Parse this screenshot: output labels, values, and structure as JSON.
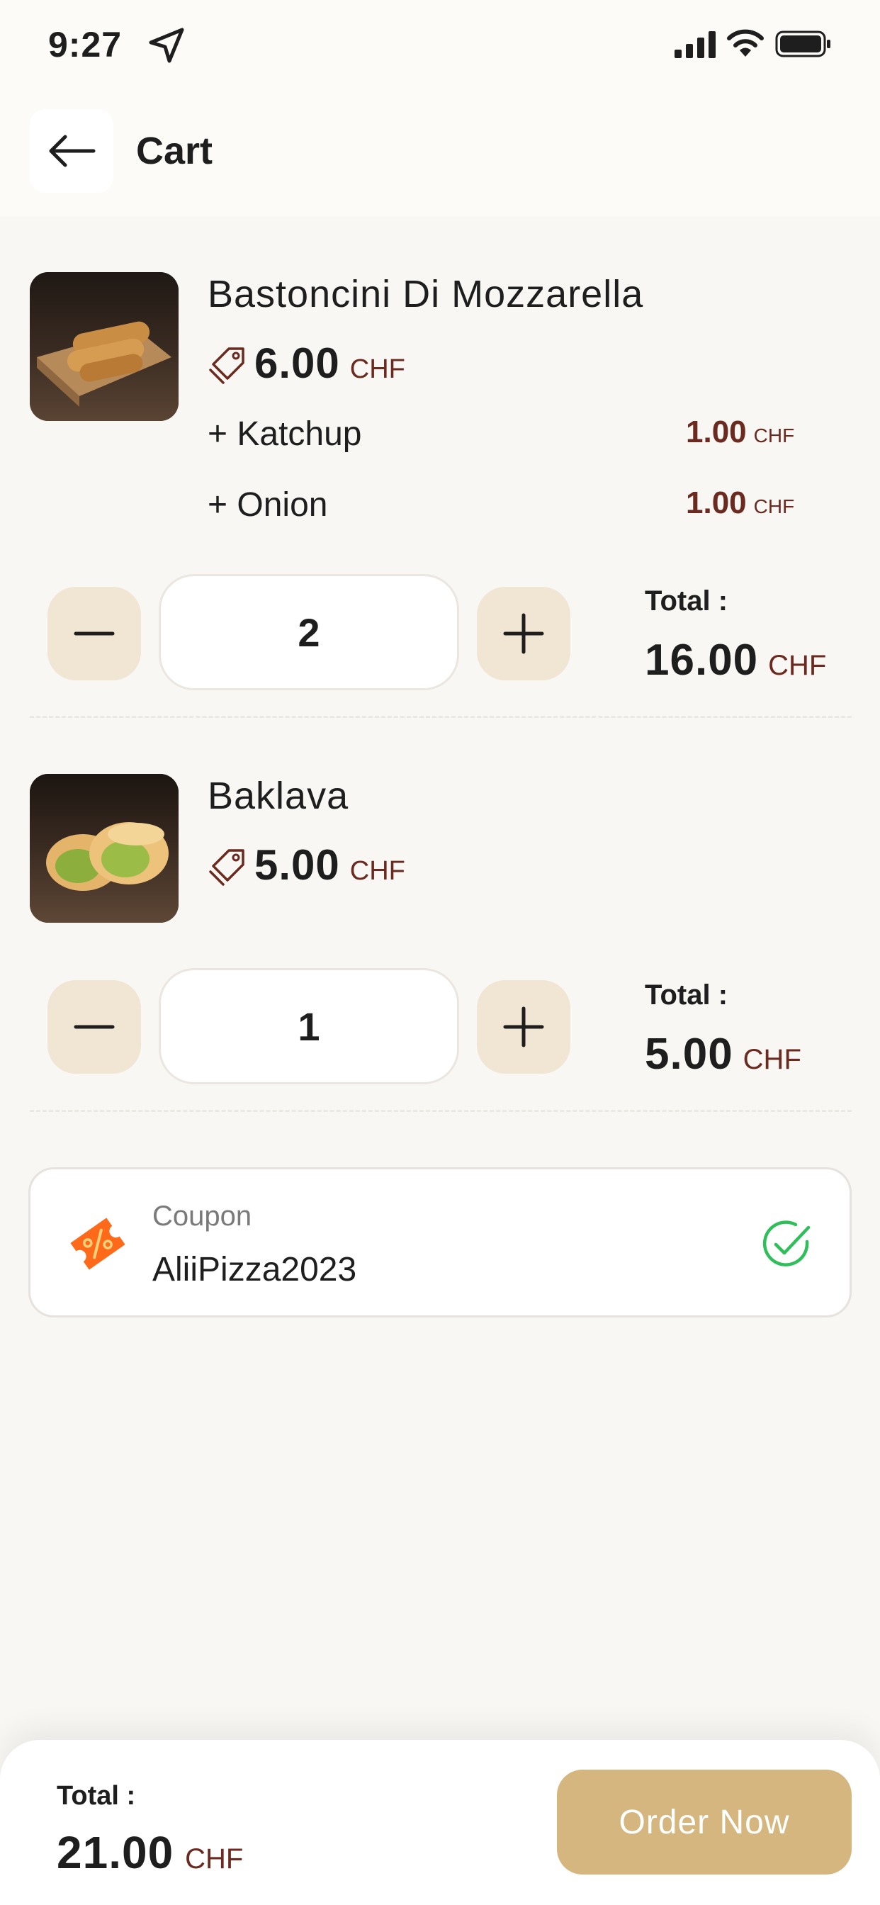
{
  "status_bar": {
    "time": "9:27"
  },
  "header": {
    "title": "Cart"
  },
  "cart": {
    "items": [
      {
        "name": "Bastoncini Di Mozzarella",
        "price": "6.00",
        "currency": "CHF",
        "extras": [
          {
            "name": "+ Katchup",
            "price": "1.00",
            "currency": "CHF"
          },
          {
            "name": "+ Onion",
            "price": "1.00",
            "currency": "CHF"
          }
        ],
        "quantity": "2",
        "total_label": "Total :",
        "total": "16.00",
        "total_currency": "CHF"
      },
      {
        "name": "Baklava",
        "price": "5.00",
        "currency": "CHF",
        "extras": [],
        "quantity": "1",
        "total_label": "Total :",
        "total": "5.00",
        "total_currency": "CHF"
      }
    ]
  },
  "coupon": {
    "label": "Coupon",
    "code": "AliiPizza2023",
    "applied": true
  },
  "footer": {
    "total_label": "Total :",
    "total": "21.00",
    "currency": "CHF",
    "order_label": "Order Now"
  },
  "colors": {
    "accent": "#d4b67e",
    "qty_button": "#f1e5d3",
    "currency": "#6b2a1f",
    "success": "#2fbf5a",
    "coupon_icon": "#ff6a1a"
  },
  "icons": {
    "back": "arrow-left-icon",
    "price_tag": "price-tag-icon",
    "decrement": "minus-icon",
    "increment": "plus-icon",
    "coupon": "coupon-ticket-icon",
    "applied": "check-circle-icon"
  }
}
